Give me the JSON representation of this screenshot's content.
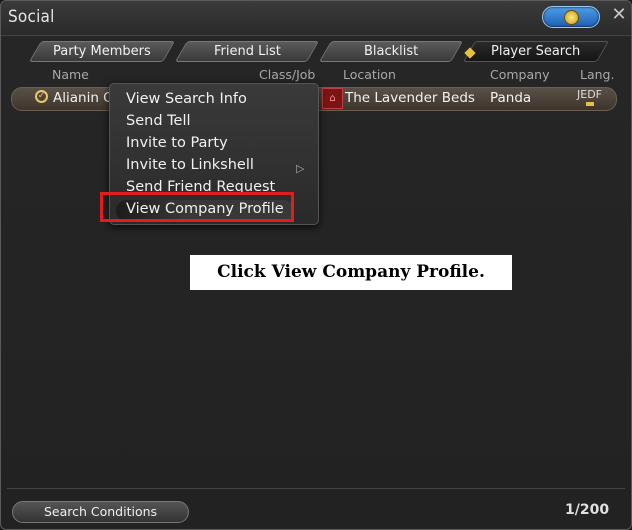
{
  "window": {
    "title": "Social"
  },
  "tabs": [
    "Party Members",
    "Friend List",
    "Blacklist",
    "Player Search"
  ],
  "columns": {
    "name": "Name",
    "class_job": "Class/Job",
    "location": "Location",
    "company": "Company",
    "lang": "Lang."
  },
  "row": {
    "name": "Alianin C",
    "location": "The Lavender Beds",
    "company": "Panda",
    "lang": "JEDF"
  },
  "context_menu": {
    "items": [
      "View Search Info",
      "Send Tell",
      "Invite to Party",
      "Invite to Linkshell",
      "Send Friend Request",
      "View Company Profile"
    ]
  },
  "instruction": "Click View Company Profile.",
  "footer": {
    "search_conditions": "Search Conditions",
    "count": "1/200"
  },
  "icons": {
    "help": "help-icon",
    "close": "close-icon",
    "location": "house-icon",
    "submenu": "triangle-right-icon"
  }
}
